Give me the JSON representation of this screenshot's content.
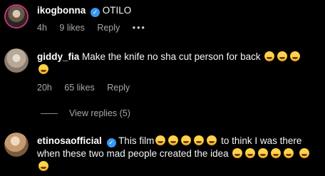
{
  "comments": [
    {
      "username": "ikogbonna",
      "verified": true,
      "text": "OTILO",
      "time": "4h",
      "likes": "9 likes",
      "reply": "Reply",
      "more": "•••"
    },
    {
      "username": "giddy_fia",
      "verified": false,
      "text": "Make the knife no sha cut person for back",
      "time": "20h",
      "likes": "65 likes",
      "reply": "Reply",
      "view_replies": "View replies (5)"
    },
    {
      "username": "etinosaofficial",
      "verified": true,
      "text_part1": "This film",
      "text_part2": "to think I was there when these two mad people created the idea"
    }
  ],
  "icons": {
    "verified": "verified-badge-icon",
    "emoji": "laughing-emoji-icon",
    "more": "more-options-icon"
  },
  "colors": {
    "background": "#000000",
    "text": "#f5f5f5",
    "meta": "#a8a8a8",
    "verified": "#3897f0"
  }
}
